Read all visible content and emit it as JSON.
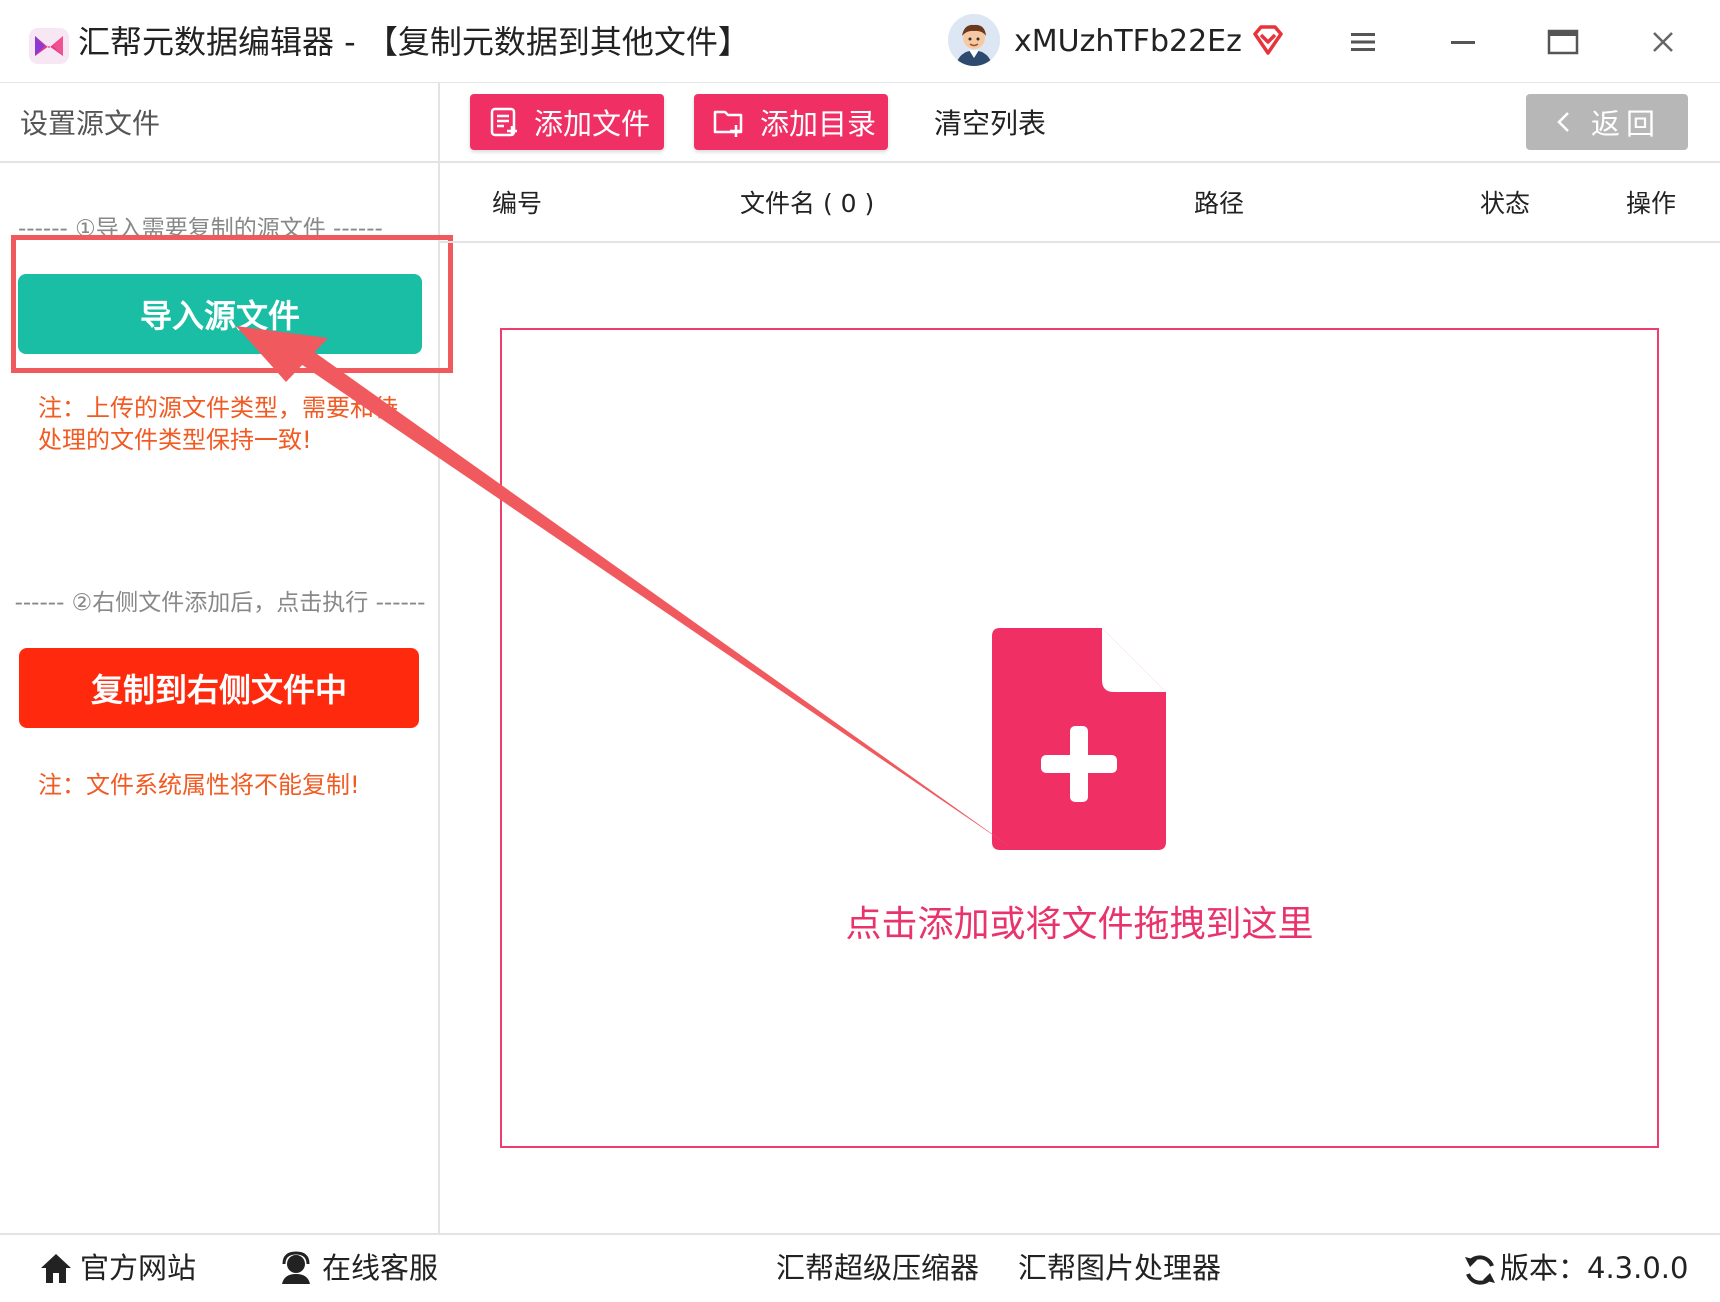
{
  "window": {
    "title": "汇帮元数据编辑器 - 【复制元数据到其他文件】",
    "username": "xMUzhTFb22Ez"
  },
  "sidebar": {
    "title": "设置源文件",
    "step1_label": "------ ①导入需要复制的源文件 ------",
    "import_button": "导入源文件",
    "note1": "注：上传的源文件类型，需要和待处理的文件类型保持一致!",
    "step2_label": "------ ②右侧文件添加后，点击执行 ------",
    "copy_button": "复制到右侧文件中",
    "note2": "注：文件系统属性将不能复制!"
  },
  "toolbar": {
    "add_file": "添加文件",
    "add_dir": "添加目录",
    "clear_list": "清空列表",
    "back": "返回"
  },
  "table": {
    "columns": [
      "编号",
      "文件名 ( 0 )",
      "路径",
      "状态",
      "操作"
    ]
  },
  "dropzone": {
    "text": "点击添加或将文件拖拽到这里"
  },
  "footer": {
    "official_site": "官方网站",
    "online_service": "在线客服",
    "compressor": "汇帮超级压缩器",
    "image_processor": "汇帮图片处理器",
    "version": "版本：4.3.0.0"
  },
  "colors": {
    "accent_pink": "#f03065",
    "teal": "#19bea5",
    "red": "#ff2a0e",
    "note_orange": "#f15a22",
    "annotation_red": "#f05a5f"
  }
}
